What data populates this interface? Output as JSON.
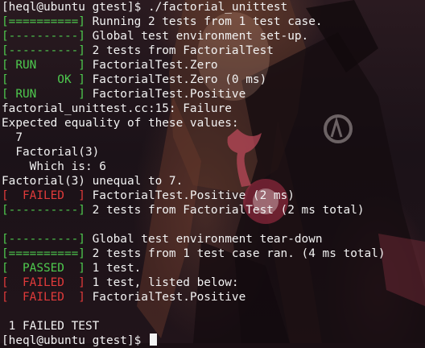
{
  "terminal": {
    "lines": [
      {
        "prefix": "",
        "prefix_color": "white",
        "text": "[heql@ubuntu gtest]$ ./factorial_unittest"
      },
      {
        "prefix": "[==========]",
        "prefix_color": "green",
        "text": " Running 2 tests from 1 test case."
      },
      {
        "prefix": "[----------]",
        "prefix_color": "green",
        "text": " Global test environment set-up."
      },
      {
        "prefix": "[----------]",
        "prefix_color": "green",
        "text": " 2 tests from FactorialTest"
      },
      {
        "prefix": "[ RUN      ]",
        "prefix_color": "green",
        "text": " FactorialTest.Zero"
      },
      {
        "prefix": "[       OK ]",
        "prefix_color": "green",
        "text": " FactorialTest.Zero (0 ms)"
      },
      {
        "prefix": "[ RUN      ]",
        "prefix_color": "green",
        "text": " FactorialTest.Positive"
      },
      {
        "prefix": "",
        "prefix_color": "white",
        "text": "factorial_unittest.cc:15: Failure"
      },
      {
        "prefix": "",
        "prefix_color": "white",
        "text": "Expected equality of these values:"
      },
      {
        "prefix": "",
        "prefix_color": "white",
        "text": "  7"
      },
      {
        "prefix": "",
        "prefix_color": "white",
        "text": "  Factorial(3)"
      },
      {
        "prefix": "",
        "prefix_color": "white",
        "text": "    Which is: 6"
      },
      {
        "prefix": "",
        "prefix_color": "white",
        "text": "Factorial(3) unequal to 7."
      },
      {
        "prefix": "[  FAILED  ]",
        "prefix_color": "red",
        "text": " FactorialTest.Positive (2 ms)"
      },
      {
        "prefix": "[----------]",
        "prefix_color": "green",
        "text": " 2 tests from FactorialTest (2 ms total)"
      },
      {
        "prefix": "",
        "prefix_color": "white",
        "text": ""
      },
      {
        "prefix": "[----------]",
        "prefix_color": "green",
        "text": " Global test environment tear-down"
      },
      {
        "prefix": "[==========]",
        "prefix_color": "green",
        "text": " 2 tests from 1 test case ran. (4 ms total)"
      },
      {
        "prefix": "[  PASSED  ]",
        "prefix_color": "green",
        "text": " 1 test."
      },
      {
        "prefix": "[  FAILED  ]",
        "prefix_color": "red",
        "text": " 1 test, listed below:"
      },
      {
        "prefix": "[  FAILED  ]",
        "prefix_color": "red",
        "text": " FactorialTest.Positive"
      },
      {
        "prefix": "",
        "prefix_color": "white",
        "text": ""
      },
      {
        "prefix": "",
        "prefix_color": "white",
        "text": " 1 FAILED TEST"
      }
    ],
    "prompt": "[heql@ubuntu gtest]$ "
  },
  "colors": {
    "green": "#4ec94e",
    "red": "#e03a3a",
    "text": "#f2f2f2",
    "background": "#1a0f14"
  }
}
